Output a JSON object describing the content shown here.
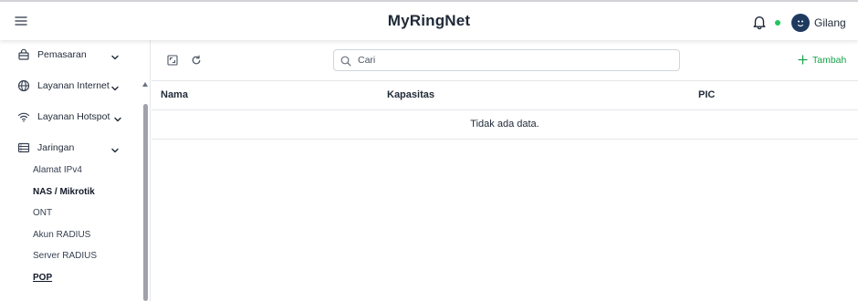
{
  "header": {
    "title": "MyRingNet",
    "user_name": "Gilang",
    "status_color": "#22c55e",
    "avatar_color": "#1e3a5f"
  },
  "sidebar": {
    "items": [
      {
        "label": "Pemasaran",
        "icon": "shop-icon",
        "expanded": false
      },
      {
        "label": "Layanan Internet",
        "icon": "globe-icon",
        "expanded": false
      },
      {
        "label": "Layanan Hotspot",
        "icon": "wifi-icon",
        "expanded": false
      },
      {
        "label": "Jaringan",
        "icon": "server-icon",
        "expanded": true
      }
    ],
    "subitems": [
      {
        "label": "Alamat IPv4"
      },
      {
        "label": "NAS / Mikrotik"
      },
      {
        "label": "ONT"
      },
      {
        "label": "Akun RADIUS"
      },
      {
        "label": "Server RADIUS"
      },
      {
        "label": "POP",
        "active": true
      }
    ]
  },
  "toolbar": {
    "search_placeholder": "Cari",
    "search_value": "",
    "add_label": "Tambah",
    "accent_color": "#16a34a"
  },
  "table": {
    "columns": [
      "Nama",
      "Kapasitas",
      "PIC"
    ],
    "empty_message": "Tidak ada data."
  }
}
